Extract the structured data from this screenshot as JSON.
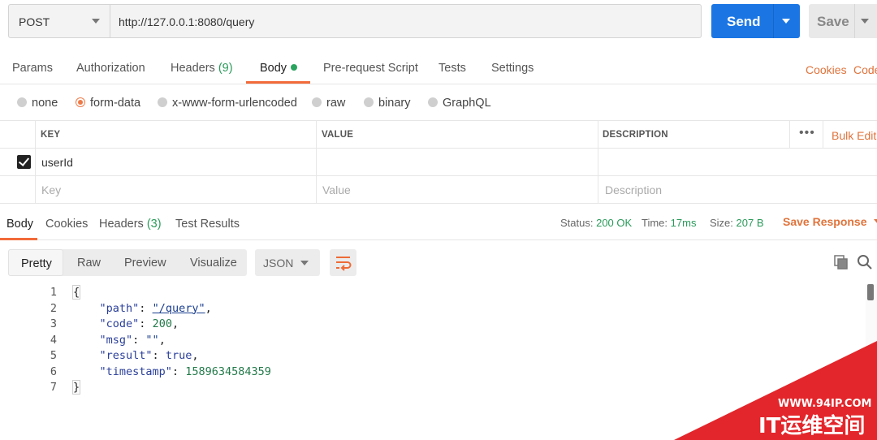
{
  "request": {
    "method": "POST",
    "url": "http://127.0.0.1:8080/query",
    "send_label": "Send",
    "save_label": "Save"
  },
  "request_tabs": {
    "params": "Params",
    "authorization": "Authorization",
    "headers": "Headers",
    "headers_count": "(9)",
    "body": "Body",
    "prerequest": "Pre-request Script",
    "tests": "Tests",
    "settings": "Settings",
    "cookies": "Cookies",
    "code": "Code"
  },
  "body_types": {
    "none": "none",
    "form_data": "form-data",
    "urlencoded": "x-www-form-urlencoded",
    "raw": "raw",
    "binary": "binary",
    "graphql": "GraphQL",
    "selected": "form-data"
  },
  "params_table": {
    "headers": {
      "key": "KEY",
      "value": "VALUE",
      "description": "DESCRIPTION"
    },
    "bulk_edit": "Bulk Edit",
    "more": "•••",
    "rows": [
      {
        "checked": true,
        "key": "userId",
        "value": "",
        "description": ""
      }
    ],
    "placeholder": {
      "key": "Key",
      "value": "Value",
      "description": "Description"
    }
  },
  "response_tabs": {
    "body": "Body",
    "cookies": "Cookies",
    "headers": "Headers",
    "headers_count": "(3)",
    "test_results": "Test Results"
  },
  "response_status": {
    "status_label": "Status:",
    "status_value": "200 OK",
    "time_label": "Time:",
    "time_value": "17ms",
    "size_label": "Size:",
    "size_value": "207 B",
    "save_response": "Save Response"
  },
  "view_modes": {
    "pretty": "Pretty",
    "raw": "Raw",
    "preview": "Preview",
    "visualize": "Visualize",
    "format": "JSON"
  },
  "response_body": {
    "line_numbers": [
      "1",
      "2",
      "3",
      "4",
      "5",
      "6",
      "7"
    ],
    "open_brace": "{",
    "close_brace": "}",
    "path_key": "\"path\"",
    "path_value": "\"/query\"",
    "code_key": "\"code\"",
    "code_value": "200",
    "msg_key": "\"msg\"",
    "msg_value": "\"\"",
    "result_key": "\"result\"",
    "result_value": "true",
    "timestamp_key": "\"timestamp\"",
    "timestamp_value": "1589634584359"
  },
  "watermark": {
    "url": "WWW.94IP.COM",
    "title": "IT运维空间"
  },
  "colors": {
    "accent": "#f26b3a",
    "send_blue": "#1b76e4",
    "success_green": "#2a9a5a",
    "watermark_red": "#e3262b"
  }
}
